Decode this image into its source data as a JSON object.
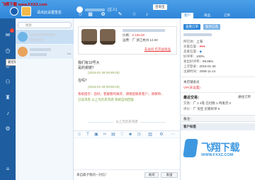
{
  "watermark_top": "飞翔下载 www.FXXZ.com",
  "header": {
    "status": "请点此设置签名",
    "chat_title": "[主人]",
    "window_tab": "咨询宝",
    "right_tabs": [
      "客户",
      "商品",
      "订单"
    ]
  },
  "tooltip": "最近联系",
  "contacts": {
    "search_placeholder": "搜索",
    "items": [
      {
        "name": "",
        "sub": "",
        "time": ""
      },
      {
        "name": "",
        "sub": "",
        "time": "1m"
      }
    ]
  },
  "chat": {
    "tools": [
      "表情",
      "截图",
      "快捷短语"
    ],
    "product": {
      "price_label": "价格：",
      "price": "¥ 108.00",
      "sold_label": "已售",
      "location_label": "运费：",
      "location": "广 浙江杭州 12.00",
      "link": "去访问 打开此商品"
    },
    "messages": [
      {
        "text": "我们有10号大",
        "type": "normal"
      },
      {
        "text": "是的谢谢？",
        "type": "normal"
      },
      {
        "text": "(2015-01-29 09:59:00)",
        "type": "ts"
      },
      {
        "text": "在吗？",
        "type": "normal"
      },
      {
        "text": "(2015-01-29 09:59:33)",
        "type": "ts"
      },
      {
        "text": "系统提示：您好，客服暂时离开，请稍后联系客户，请保持...",
        "type": "sys"
      },
      {
        "text": "已读消息 以上为历史消息 系统自动回复",
        "type": "sys2"
      }
    ],
    "divider": "以上为历史消息",
    "footer_note": "来自最子晚的一封信！",
    "close_button": "关闭",
    "send_button": "发送"
  },
  "right_panel": {
    "add_button": "查看订单",
    "buyer_button": "服务信息",
    "lines": [
      {
        "k": "所在地：",
        "v": "上海"
      },
      {
        "k": "买家信誉：",
        "v": "♥♥♥"
      },
      {
        "k": "卖家信誉：",
        "v": "◆"
      },
      {
        "k": "好评率：",
        "v": "100%"
      },
      {
        "k": "发出好评率：",
        "v": "99.89%"
      },
      {
        "k": "上次登录：",
        "v": "2015-01-30"
      },
      {
        "k": "注册时间：",
        "v": "2008-11-14"
      }
    ],
    "store_vip": "本店铺会员",
    "vip_status": "VIP(未设置)",
    "recent_trade": "最近交易：",
    "trade_link": "更多 ▸",
    "trade_lines": [
      {
        "k": "交易：",
        "v": "广 1 4笔 已付款 1 待发货 0"
      },
      {
        "k": "评价：",
        "v": "广 淘宝 买家好评 0"
      }
    ],
    "trade_total": "通往订单",
    "note_label": "备注：",
    "profile_label": "客户标签"
  },
  "watermark_corner": {
    "text": "飞翔下载",
    "url": "WWW.FXXZ.COM"
  }
}
